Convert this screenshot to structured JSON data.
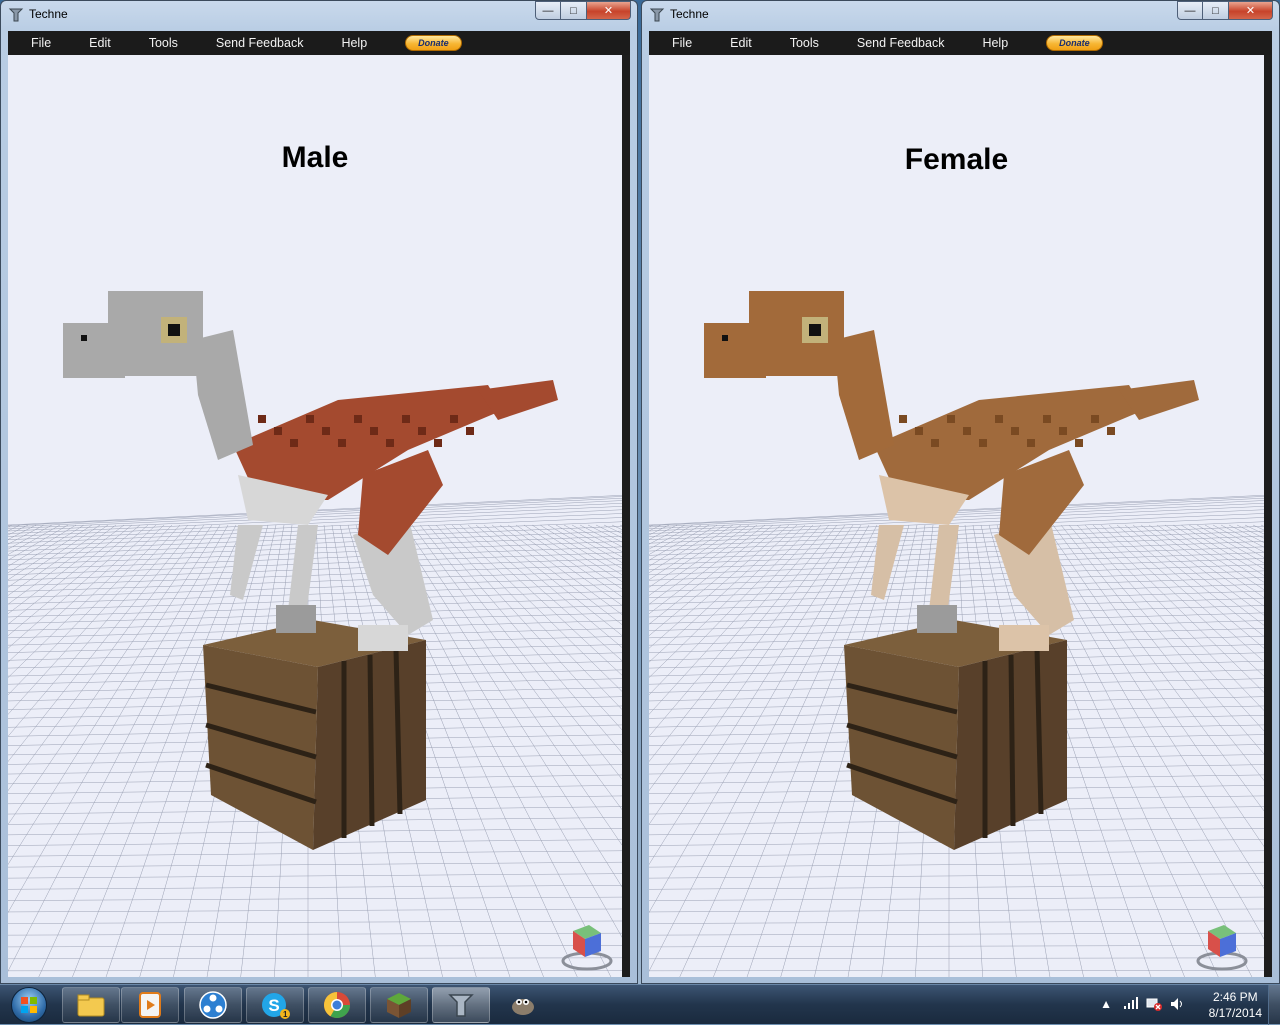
{
  "windows": [
    {
      "title": "Techne",
      "menu": [
        "File",
        "Edit",
        "Tools",
        "Send Feedback",
        "Help"
      ],
      "donate_label": "Donate",
      "model_label": "Male",
      "palette": {
        "head": "#a9a9a9",
        "body": "#a44a2f",
        "belly": "#d7d7d7",
        "legs": "#c9c9c9",
        "spots": "#6e2a17"
      }
    },
    {
      "title": "Techne",
      "menu": [
        "File",
        "Edit",
        "Tools",
        "Send Feedback",
        "Help"
      ],
      "donate_label": "Donate",
      "model_label": "Female",
      "palette": {
        "head": "#a26a3a",
        "body": "#a06a3c",
        "belly": "#dcc3a8",
        "legs": "#d6bfa6",
        "spots": "#7a4a22"
      }
    }
  ],
  "taskbar": {
    "apps": [
      "windows-explorer",
      "media-player",
      "network-app",
      "skype",
      "chrome",
      "minecraft",
      "techne",
      "gimp"
    ],
    "skype_badge": "1",
    "clock_time": "2:46 PM",
    "clock_date": "8/17/2014"
  },
  "colors": {
    "viewport_bg": "#eceef8",
    "menubar_bg": "#1b1b1b",
    "grid_line": "#9aa0b3"
  }
}
